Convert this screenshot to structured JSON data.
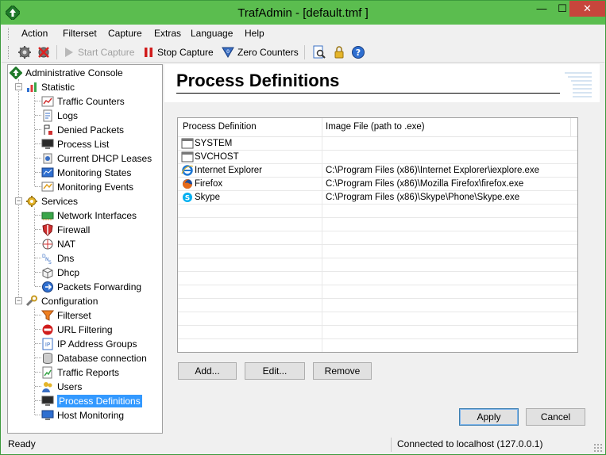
{
  "window": {
    "title": "TrafAdmin - [default.tmf ]",
    "minimize": "—",
    "maximize": "☐",
    "close": "✕"
  },
  "menu": [
    "Action",
    "Filterset",
    "Capture",
    "Extras",
    "Language",
    "Help"
  ],
  "toolbar": {
    "start_capture": "Start Capture",
    "stop_capture": "Stop Capture",
    "zero_counters": "Zero Counters"
  },
  "tree": {
    "root": "Administrative Console",
    "statistic": {
      "label": "Statistic",
      "items": [
        "Traffic Counters",
        "Logs",
        "Denied Packets",
        "Process List",
        "Current DHCP Leases",
        "Monitoring States",
        "Monitoring Events"
      ]
    },
    "services": {
      "label": "Services",
      "items": [
        "Network Interfaces",
        "Firewall",
        "NAT",
        "Dns",
        "Dhcp",
        "Packets Forwarding"
      ]
    },
    "configuration": {
      "label": "Configuration",
      "items": [
        "Filterset",
        "URL Filtering",
        "IP Address Groups",
        "Database connection",
        "Traffic Reports",
        "Users",
        "Process Definitions",
        "Host Monitoring"
      ]
    },
    "selected": "Process Definitions"
  },
  "page": {
    "title": "Process Definitions"
  },
  "table": {
    "columns": [
      "Process Definition",
      "Image File (path to .exe)"
    ],
    "rows": [
      {
        "name": "SYSTEM",
        "path": "",
        "icon": "window-icon"
      },
      {
        "name": "SVCHOST",
        "path": "",
        "icon": "window-icon"
      },
      {
        "name": "Internet Explorer",
        "path": "C:\\Program Files (x86)\\Internet Explorer\\iexplore.exe",
        "icon": "internet-explorer-icon"
      },
      {
        "name": "Firefox",
        "path": "C:\\Program Files (x86)\\Mozilla Firefox\\firefox.exe",
        "icon": "firefox-icon"
      },
      {
        "name": "Skype",
        "path": "C:\\Program Files (x86)\\Skype\\Phone\\Skype.exe",
        "icon": "skype-icon"
      }
    ]
  },
  "buttons": {
    "add": "Add...",
    "edit": "Edit...",
    "remove": "Remove",
    "apply": "Apply",
    "cancel": "Cancel"
  },
  "status": {
    "left": "Ready",
    "right": "Connected to localhost (127.0.0.1)"
  },
  "colors": {
    "titlebar": "#5bbd4f",
    "close_button": "#c7463c",
    "selection": "#3399ff"
  }
}
